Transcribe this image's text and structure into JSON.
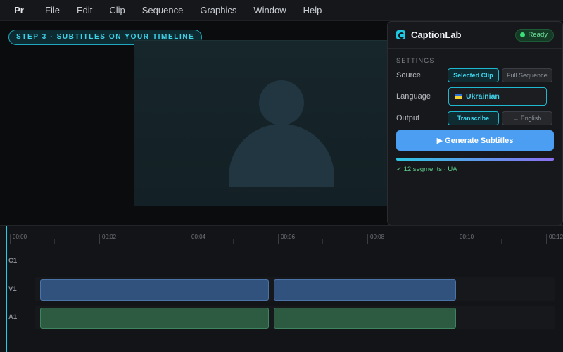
{
  "app": {
    "logo": "Pr"
  },
  "menu": [
    "File",
    "Edit",
    "Clip",
    "Sequence",
    "Graphics",
    "Window",
    "Help"
  ],
  "program": {
    "step_badge": "STEP 3 · SUBTITLES ON YOUR TIMELINE"
  },
  "panel": {
    "title": "CaptionLab",
    "status": "Ready",
    "section_label": "SETTINGS",
    "source": {
      "label": "Source",
      "options": [
        "Selected Clip",
        "Full Sequence"
      ],
      "selected": "Selected Clip"
    },
    "language": {
      "label": "Language",
      "value": "Ukrainian"
    },
    "output": {
      "label": "Output",
      "options": [
        "Transcribe",
        "→ English"
      ],
      "selected": "Transcribe"
    },
    "generate_label": "▶ Generate Subtitles",
    "progress": 1.0,
    "status_text": "✓ 12 segments · UA"
  },
  "timeline": {
    "timecodes": [
      "00:00",
      "00:02",
      "00:04",
      "00:06",
      "00:08",
      "00:10",
      "00:12"
    ],
    "tracks": [
      "C1",
      "V1",
      "A1"
    ]
  },
  "colors": {
    "accent": "#1fb8d1",
    "primary_button": "#4b9ef2",
    "ready": "#3ddc7a",
    "video_clip": "#32527e",
    "audio_clip": "#2c5b42"
  }
}
